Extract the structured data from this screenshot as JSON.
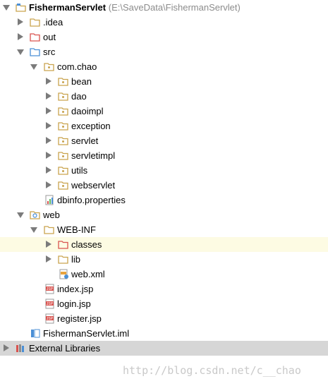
{
  "tree": {
    "root": {
      "name": "FishermanServlet",
      "path": "(E:\\SaveData\\FishermanServlet)"
    },
    "idea": ".idea",
    "out": "out",
    "src": "src",
    "package": "com.chao",
    "pkg_items": [
      "bean",
      "dao",
      "daoimpl",
      "exception",
      "servlet",
      "servletimpl",
      "utils",
      "webservlet"
    ],
    "dbinfo": "dbinfo.properties",
    "web": "web",
    "webinf": "WEB-INF",
    "classes": "classes",
    "lib": "lib",
    "webxml": "web.xml",
    "jsp_files": [
      "index.jsp",
      "login.jsp",
      "register.jsp"
    ],
    "iml": "FishermanServlet.iml",
    "external": "External Libraries"
  },
  "watermark": "http://blog.csdn.net/c__chao",
  "colors": {
    "selected": "#d6d6d6",
    "highlight": "#fdfbe3",
    "folder": "#c9a34e",
    "excluded": "#d9534f",
    "source": "#4a8fd6"
  }
}
